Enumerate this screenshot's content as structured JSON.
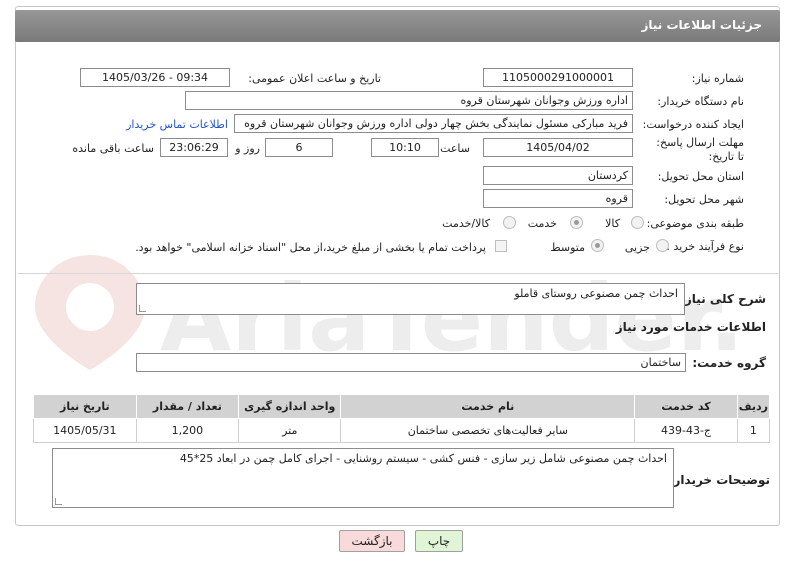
{
  "header": {
    "title": "جزئیات اطلاعات نیاز"
  },
  "labels": {
    "need_number": "شماره نیاز:",
    "public_date": "تاریخ و ساعت اعلان عمومی:",
    "buyer_org": "نام دستگاه خریدار:",
    "creator": "ایجاد کننده درخواست:",
    "contact": "اطلاعات تماس خریدار",
    "deadline": "مهلت ارسال پاسخ: تا تاریخ:",
    "time": "ساعت",
    "day_and": "روز و",
    "hours_left": "ساعت باقی مانده",
    "province": "استان محل تحویل:",
    "city": "شهر محل تحویل:",
    "category": "طبقه بندی موضوعی:",
    "process_type": "نوع فرآیند خرید :",
    "general_desc": "شرح کلی نیاز:",
    "services_info": "اطلاعات خدمات مورد نیاز",
    "service_group": "گروه خدمت:",
    "buyer_notes": "توضیحات خریدار:"
  },
  "values": {
    "need_number": "1105000291000001",
    "public_date": "1405/03/26 - 09:34",
    "buyer_org": "اداره ورزش وجوانان شهرستان قروه",
    "creator": "فرید مبارکی مسئول نمایندگی بخش چهار دولی اداره ورزش وجوانان شهرستان قروه",
    "deadline_date": "1405/04/02",
    "deadline_time": "10:10",
    "days": "6",
    "remaining": "23:06:29",
    "province": "کردستان",
    "city": "قروه",
    "general_desc": "احداث چمن مصنوعی روستای قاملو",
    "service_group": "ساختمان",
    "buyer_notes": "احداث چمن مصنوعی شامل زیر سازی - فنس کشی - سیستم روشنایی - اجرای کامل چمن در ابعاد 25*45"
  },
  "category_options": {
    "goods": "کالا",
    "service": "خدمت",
    "goods_service": "کالا/خدمت",
    "selected": "service"
  },
  "process_options": {
    "partial": "جزیی",
    "medium": "متوسط",
    "selected": "medium",
    "treasury_note": "پرداخت تمام یا بخشی از مبلغ خرید،از محل \"اسناد خزانه اسلامی\" خواهد بود."
  },
  "table": {
    "headers": [
      "ردیف",
      "کد خدمت",
      "نام خدمت",
      "واحد اندازه گیری",
      "تعداد / مقدار",
      "تاریخ نیاز"
    ],
    "rows": [
      [
        "1",
        "ج-43-439",
        "سایر فعالیت‌های تخصصی ساختمان",
        "متر",
        "1,200",
        "1405/05/31"
      ]
    ]
  },
  "buttons": {
    "print": "چاپ",
    "back": "بازگشت"
  },
  "colors": {
    "header_bg": "#858585",
    "link": "#2457c5",
    "print_bg": "#dff5d6",
    "back_bg": "#f8dada"
  }
}
